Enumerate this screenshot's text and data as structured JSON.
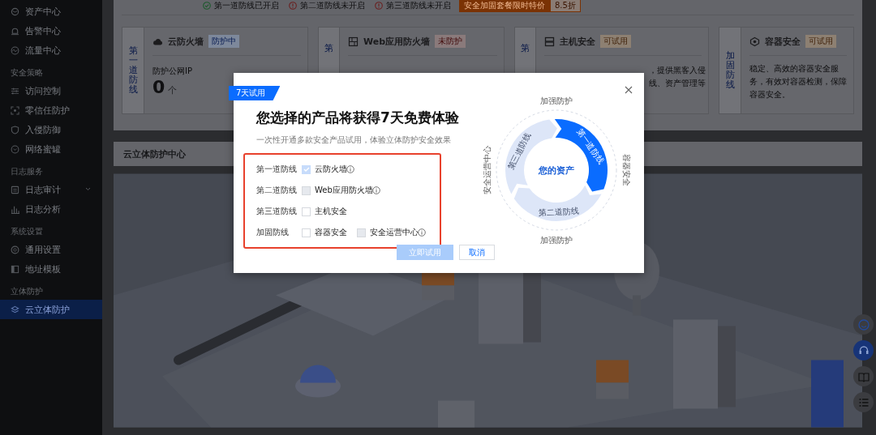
{
  "sidebar": {
    "groups": [
      {
        "items": [
          {
            "label": "资产中心",
            "selected": false,
            "kind": "link"
          },
          {
            "label": "告警中心",
            "selected": false,
            "kind": "link"
          },
          {
            "label": "流量中心",
            "selected": false,
            "kind": "link"
          }
        ]
      },
      {
        "title": "安全策略",
        "items": [
          {
            "label": "访问控制",
            "selected": false,
            "kind": "link"
          },
          {
            "label": "零信任防护",
            "selected": false,
            "kind": "link"
          },
          {
            "label": "入侵防御",
            "selected": false,
            "kind": "link"
          },
          {
            "label": "网络蜜罐",
            "selected": false,
            "kind": "link"
          }
        ]
      },
      {
        "title": "日志服务",
        "items": [
          {
            "label": "日志审计",
            "selected": false,
            "kind": "submenu"
          },
          {
            "label": "日志分析",
            "selected": false,
            "kind": "link"
          }
        ]
      },
      {
        "title": "系统设置",
        "items": [
          {
            "label": "通用设置",
            "selected": false,
            "kind": "link"
          },
          {
            "label": "地址模板",
            "selected": false,
            "kind": "link"
          }
        ]
      },
      {
        "title": "立体防护",
        "items": [
          {
            "label": "云立体防护",
            "selected": true,
            "kind": "link"
          }
        ]
      }
    ]
  },
  "status_bar": {
    "items": [
      {
        "label": "第一道防线已开启",
        "on": true
      },
      {
        "label": "第二道防线未开启",
        "on": false
      },
      {
        "label": "第三道防线未开启",
        "on": false
      }
    ],
    "promo": {
      "label": "安全加固套餐限时特价",
      "discount": "8.5折"
    }
  },
  "cards": [
    {
      "tab": "第一道防线",
      "title": "云防火墙",
      "badge": {
        "label": "防护中",
        "kind": "active"
      },
      "metric": {
        "label": "防护公网IP",
        "value": "0",
        "unit": "个"
      }
    },
    {
      "tab": "第",
      "title": "Web应用防火墙",
      "badge": {
        "label": "未防护",
        "kind": "off"
      }
    },
    {
      "tab": "第",
      "title": "主机安全",
      "badge": {
        "label": "可试用",
        "kind": "trial"
      },
      "fragments": [
        "，提供黑客入侵",
        "线、资产管理等"
      ]
    },
    {
      "tab": "加固防线",
      "title": "容器安全",
      "badge": {
        "label": "可试用",
        "kind": "trial"
      },
      "description": "稳定、高效的容器安全服务，有效对容器检测，保障容器安全。"
    }
  ],
  "section": {
    "title": "云立体防护中心"
  },
  "float_buttons": [
    {
      "selected": false
    },
    {
      "selected": true
    },
    {
      "selected": false
    },
    {
      "selected": false
    }
  ],
  "modal": {
    "ribbon": "7天试用",
    "title": "您选择的产品将获得7天免费体验",
    "subtitle": "一次性开通多款安全产品试用，体验立体防护安全效果",
    "rows": [
      {
        "label": "第一道防线",
        "options": [
          {
            "label": "云防火墙",
            "checked": true,
            "disabled": true,
            "info": true
          }
        ]
      },
      {
        "label": "第二道防线",
        "options": [
          {
            "label": "Web应用防火墙",
            "checked": false,
            "disabled": true,
            "info": true
          }
        ]
      },
      {
        "label": "第三道防线",
        "options": [
          {
            "label": "主机安全",
            "checked": false,
            "disabled": false,
            "info": false
          }
        ]
      },
      {
        "label": "加固防线",
        "options": [
          {
            "label": "容器安全",
            "checked": false,
            "disabled": false,
            "info": false
          },
          {
            "label": "安全运营中心",
            "checked": false,
            "disabled": true,
            "info": true
          }
        ]
      }
    ],
    "buttons": [
      {
        "label": "立即试用",
        "kind": "primary",
        "disabled": true
      },
      {
        "label": "取消",
        "kind": "default",
        "disabled": false
      }
    ],
    "diagram": {
      "center": "您的资产",
      "segments": [
        {
          "label": "第一道防线",
          "selected": true
        },
        {
          "label": "第二道防线",
          "selected": false
        },
        {
          "label": "第三道防线",
          "selected": false
        }
      ],
      "outer_labels": [
        "加强防护",
        "容器安全",
        "加强防护",
        "安全运营中心"
      ]
    }
  }
}
